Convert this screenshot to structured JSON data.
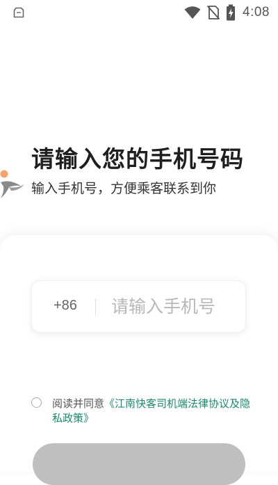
{
  "status_bar": {
    "time": "4:08",
    "left_icon": "sim-card-outline-icon",
    "right_icons": [
      "wifi-icon",
      "no-sim-icon",
      "battery-charging-icon"
    ]
  },
  "logo": {
    "icon": "swallow-bird-logo-icon",
    "colors": {
      "bird": "#8a8a8a",
      "dot": "#f5a36a"
    }
  },
  "header": {
    "title": "请输入您的手机号码",
    "subtitle": "输入手机号，方便乘客联系到你"
  },
  "phone_field": {
    "country_code": "+86",
    "value": "",
    "placeholder": "请输入手机号"
  },
  "agreement": {
    "checked": false,
    "prefix": "阅读并同意",
    "link": "《江南快客司机端法律协议及隐私政策》"
  },
  "next_button": {
    "label": ""
  },
  "colors": {
    "accent_link": "#1a8a6e",
    "button_disabled": "#bfbfbf"
  }
}
